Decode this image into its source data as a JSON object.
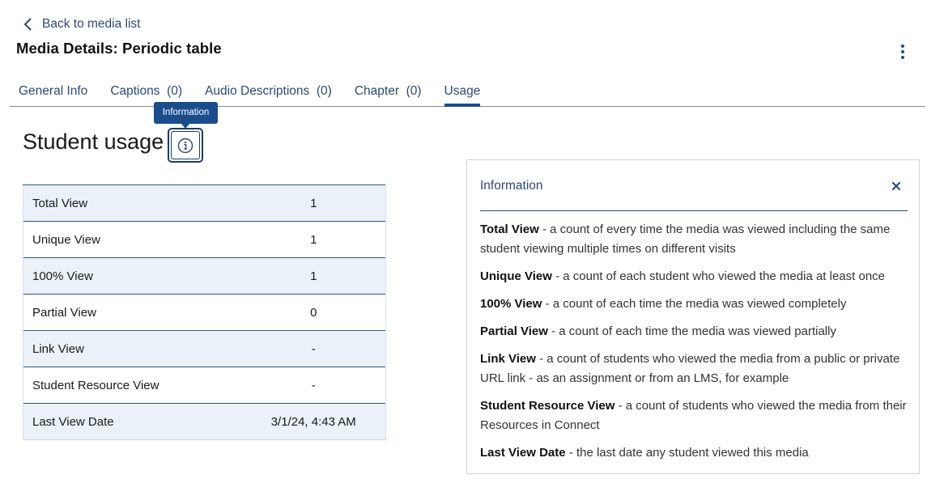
{
  "nav": {
    "back_label": "Back to media list"
  },
  "page": {
    "title": "Media Details: Periodic table"
  },
  "tabs": [
    {
      "label": "General Info",
      "active": false
    },
    {
      "label": "Captions  (0)",
      "active": false
    },
    {
      "label": "Audio Descriptions  (0)",
      "active": false
    },
    {
      "label": "Chapter  (0)",
      "active": false
    },
    {
      "label": "Usage",
      "active": true
    }
  ],
  "tooltip": {
    "text": "Information"
  },
  "section": {
    "title": "Student usage",
    "info_button_icon": "info-circle-icon"
  },
  "usage_table": {
    "rows": [
      {
        "label": "Total View",
        "value": "1"
      },
      {
        "label": "Unique View",
        "value": "1"
      },
      {
        "label": "100% View",
        "value": "1"
      },
      {
        "label": "Partial View",
        "value": "0"
      },
      {
        "label": "Link View",
        "value": "-"
      },
      {
        "label": "Student Resource View",
        "value": "-"
      },
      {
        "label": "Last View Date",
        "value": "3/1/24, 4:43 AM"
      }
    ]
  },
  "info_panel": {
    "title": "Information",
    "close_icon": "close-icon",
    "definitions": [
      {
        "term": "Total View",
        "desc": " - a count of every time the media was viewed including the same student viewing multiple times on different visits"
      },
      {
        "term": "Unique View",
        "desc": " - a count of each student who viewed the media at least once"
      },
      {
        "term": "100% View",
        "desc": " - a count of each time the media was viewed completely"
      },
      {
        "term": "Partial View",
        "desc": " - a count of each time the media was viewed partially"
      },
      {
        "term": "Link View",
        "desc": " - a count of students who viewed the media from a public or private URL link - as an assignment or from an LMS, for example"
      },
      {
        "term": "Student Resource View",
        "desc": " - a count of students who viewed the media from their Resources in Connect"
      },
      {
        "term": "Last View Date",
        "desc": " - the last date any student viewed this media"
      }
    ]
  },
  "colors": {
    "accent": "#1a4d8c",
    "link": "#2c4a73",
    "row_alt": "#eaf1f8"
  }
}
